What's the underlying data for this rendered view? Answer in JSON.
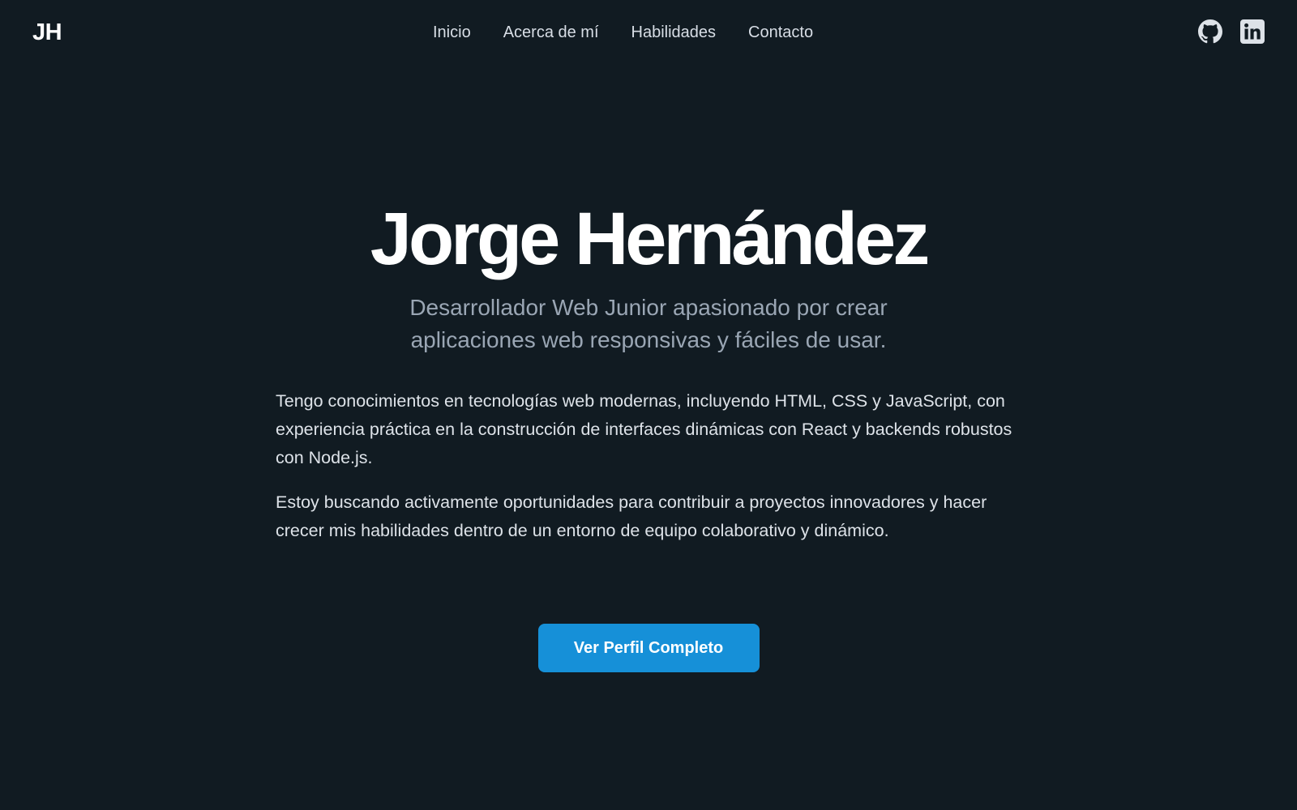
{
  "header": {
    "logo": "JH",
    "nav": [
      "Inicio",
      "Acerca de mí",
      "Habilidades",
      "Contacto"
    ],
    "social": [
      {
        "icon": "github-icon",
        "label": "GitHub"
      },
      {
        "icon": "linkedin-icon",
        "label": "LinkedIn"
      }
    ]
  },
  "hero": {
    "name": "Jorge Hernández",
    "subtitle": "Desarrollador Web Junior apasionado por crear aplicaciones web responsivas y fáciles de usar."
  },
  "about": {
    "paragraphs": [
      "Tengo conocimientos en tecnologías web modernas, incluyendo HTML, CSS y JavaScript, con experiencia práctica en la construcción de interfaces dinámicas con React y backends robustos con Node.js.",
      "Estoy buscando activamente oportunidades para contribuir a proyectos innovadores y hacer crecer mis habilidades dentro de un entorno de equipo colaborativo y dinámico."
    ]
  },
  "cta": {
    "label": "Ver Perfil Completo"
  },
  "colors": {
    "background": "#111b22",
    "accent": "#1690d8",
    "subtitle": "#9aa6b4",
    "body_text": "#dde2e8"
  }
}
